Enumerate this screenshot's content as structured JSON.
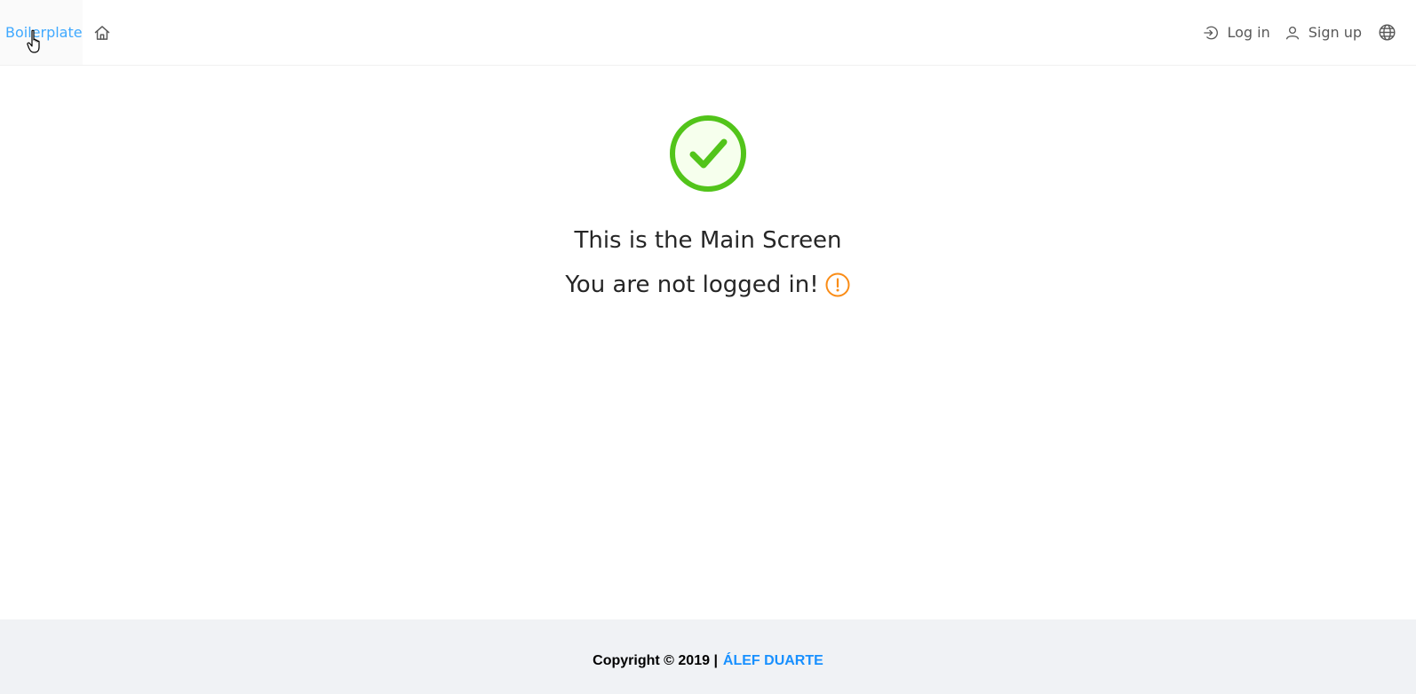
{
  "header": {
    "brand": "Boilerplate",
    "home_icon": "home-icon",
    "login_label": "Log in",
    "login_icon": "login-icon",
    "signup_label": "Sign up",
    "signup_icon": "user-icon",
    "language_icon": "globe-icon"
  },
  "main": {
    "status_icon": "check-circle-icon",
    "title": "This is the Main Screen",
    "status_text": "You are not logged in!",
    "warning_icon": "exclamation-circle-icon"
  },
  "footer": {
    "copyright": "Copyright © 2019 |",
    "author": "ÁLEF DUARTE"
  },
  "colors": {
    "brand_link": "#40a9ff",
    "success": "#52c41a",
    "warning": "#fa8c16",
    "footer_bg": "#f0f2f5",
    "footer_link": "#1890ff"
  }
}
